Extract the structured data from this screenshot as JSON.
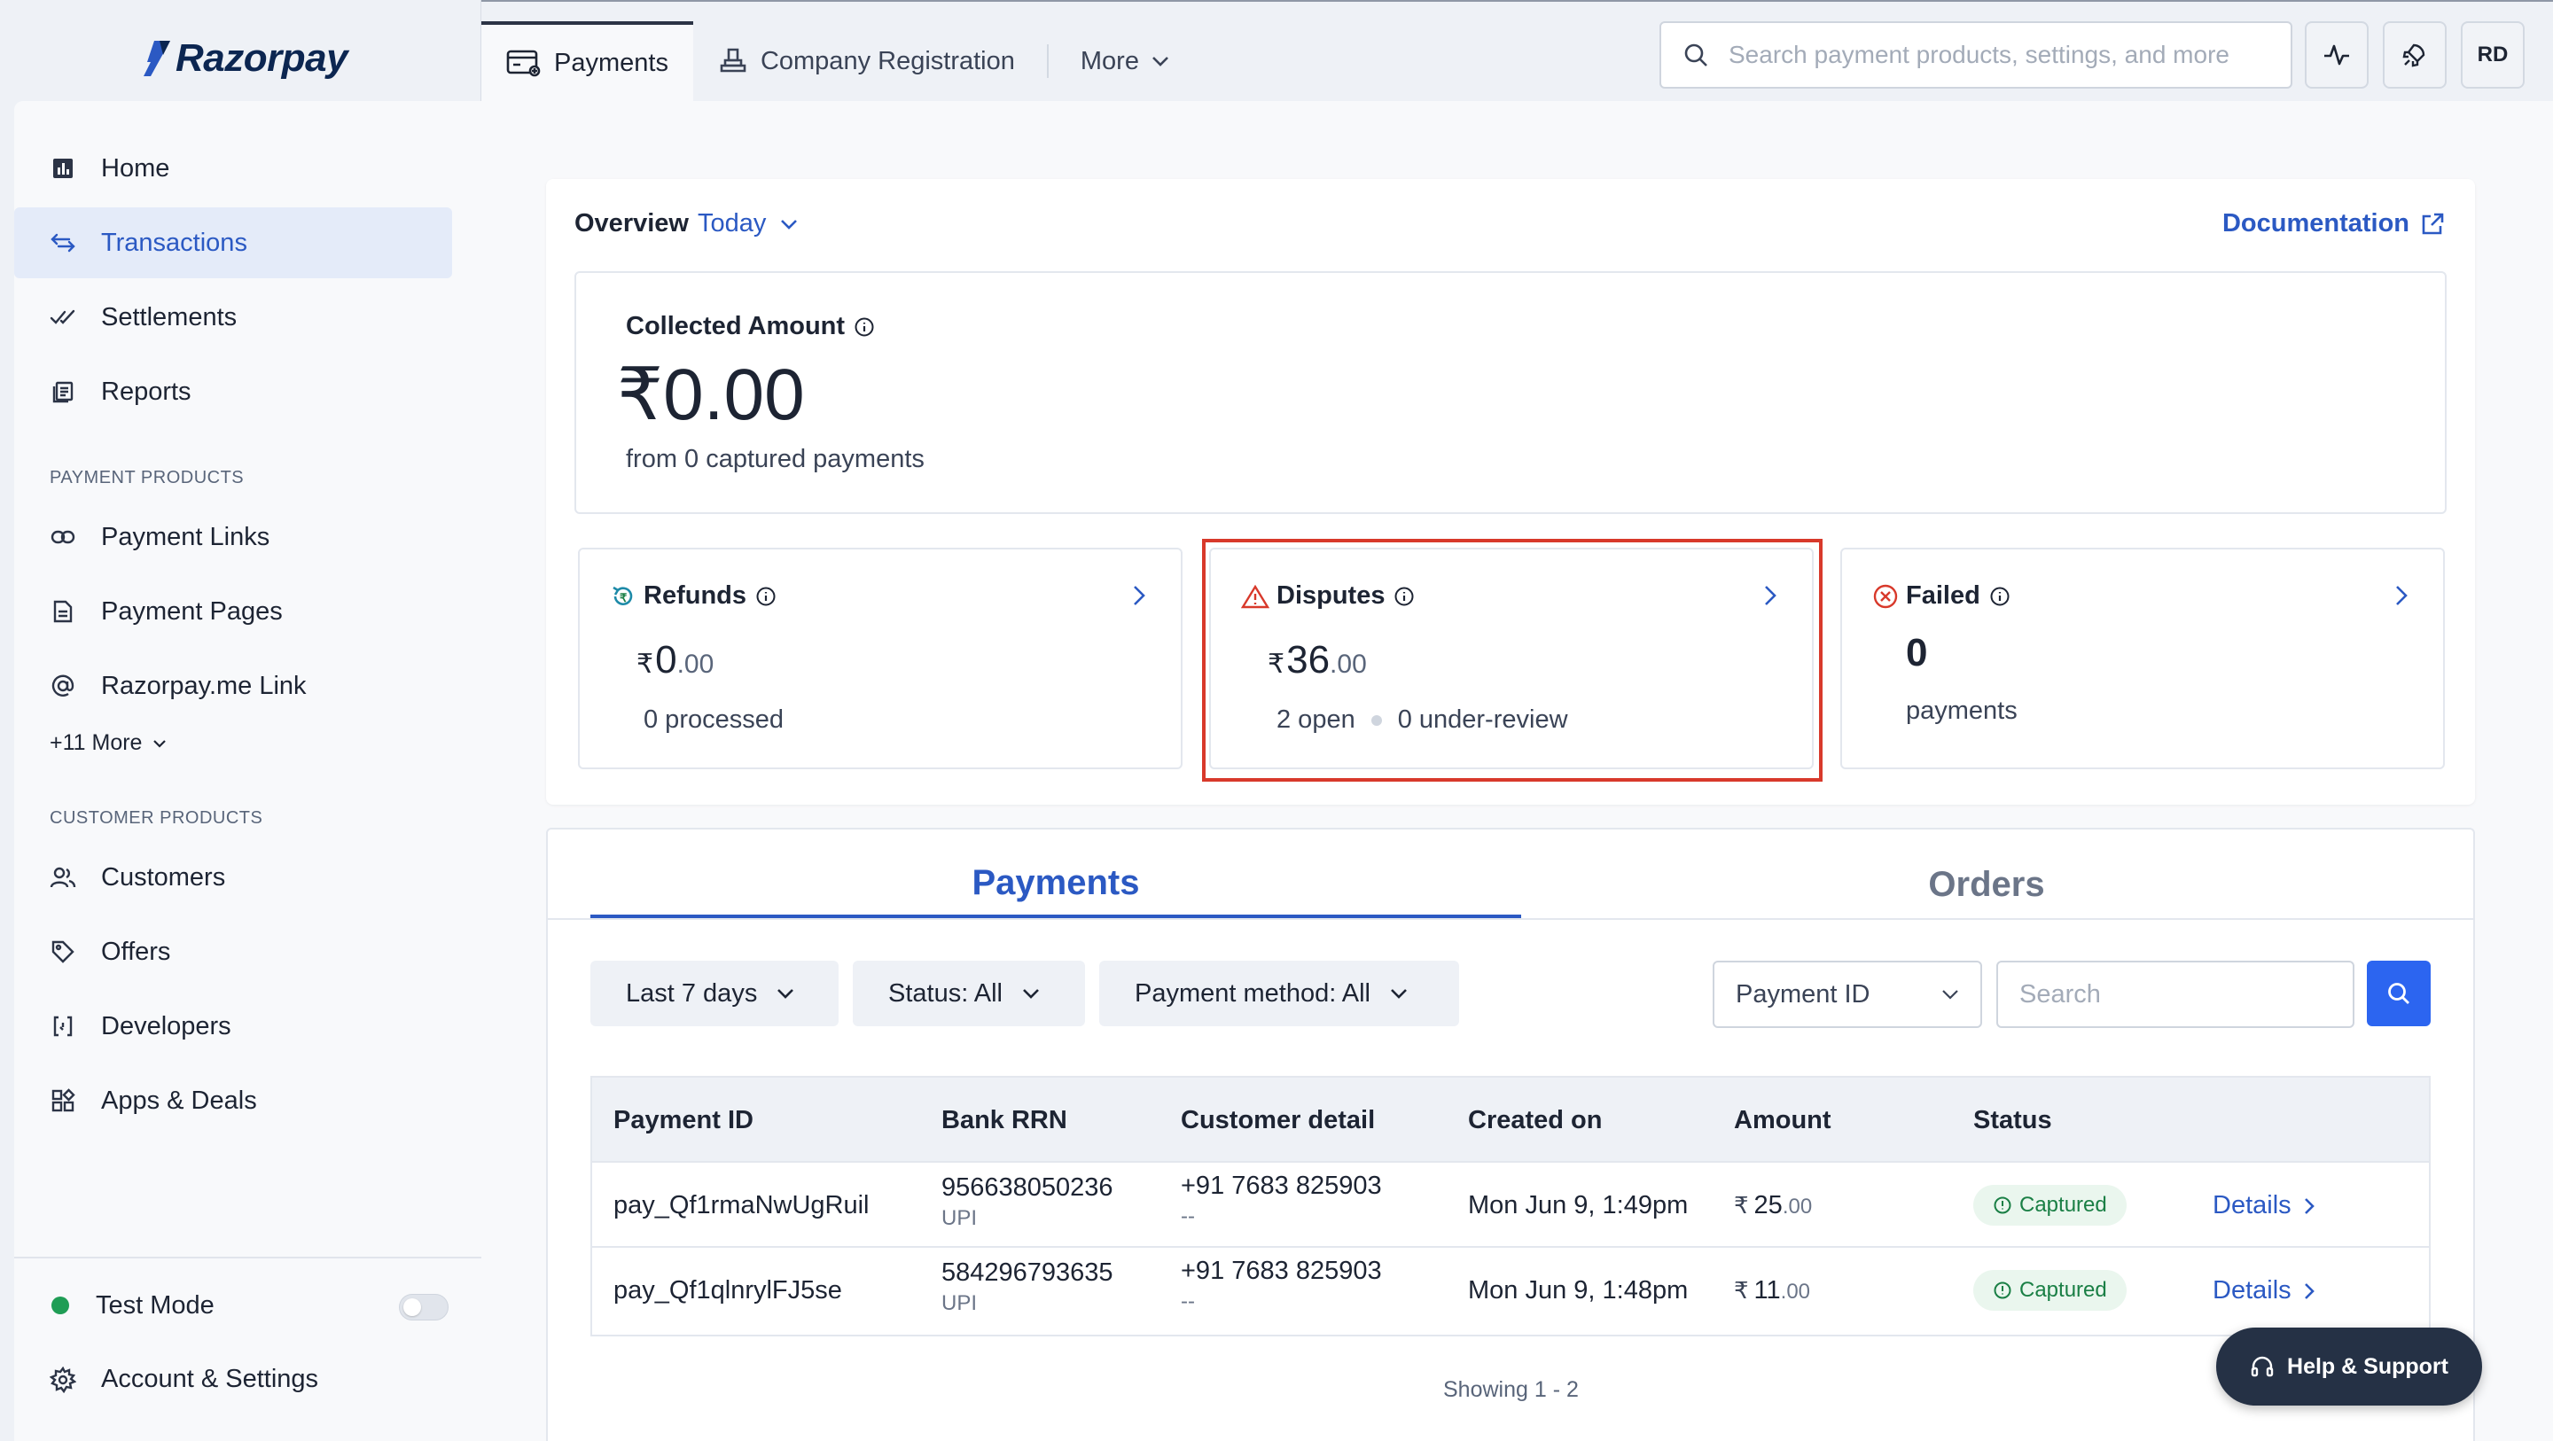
{
  "app": {
    "logo_text": "Razorpay",
    "brand_color": "#2b59c3"
  },
  "sidebar": {
    "items_top": [
      {
        "label": "Home",
        "icon": "bar-chart-icon"
      },
      {
        "label": "Transactions",
        "icon": "arrows-exchange-icon",
        "active": true
      },
      {
        "label": "Settlements",
        "icon": "double-check-icon"
      },
      {
        "label": "Reports",
        "icon": "reports-icon"
      }
    ],
    "payment_products_label": "PAYMENT PRODUCTS",
    "payment_products": [
      {
        "label": "Payment Links",
        "icon": "link-icon"
      },
      {
        "label": "Payment Pages",
        "icon": "page-icon"
      },
      {
        "label": "Razorpay.me Link",
        "icon": "at-icon"
      }
    ],
    "more_label": "+11 More",
    "customer_products_label": "CUSTOMER PRODUCTS",
    "customer_products": [
      {
        "label": "Customers",
        "icon": "users-icon"
      },
      {
        "label": "Offers",
        "icon": "tag-icon"
      },
      {
        "label": "Developers",
        "icon": "code-icon"
      },
      {
        "label": "Apps & Deals",
        "icon": "apps-icon"
      }
    ],
    "test_mode_label": "Test Mode",
    "account_label": "Account & Settings"
  },
  "topnav": {
    "tabs": [
      {
        "label": "Payments",
        "icon": "payments-icon",
        "active": true
      },
      {
        "label": "Company Registration",
        "icon": "stamp-icon"
      },
      {
        "label": "More",
        "icon": "chevron-down-icon"
      }
    ],
    "search_placeholder": "Search payment products, settings, and more",
    "avatar_initials": "RD"
  },
  "overview": {
    "title": "Overview",
    "period": "Today",
    "documentation_label": "Documentation",
    "collected": {
      "label": "Collected Amount",
      "amount": "₹0.00",
      "sub": "from 0 captured payments"
    },
    "refunds": {
      "label": "Refunds",
      "currency": "₹",
      "whole": "0",
      "decimal": ".00",
      "desc": "0 processed"
    },
    "disputes": {
      "label": "Disputes",
      "currency": "₹",
      "whole": "36",
      "decimal": ".00",
      "open": "2 open",
      "review": "0 under-review"
    },
    "failed": {
      "label": "Failed",
      "value": "0",
      "desc": "payments"
    }
  },
  "payments": {
    "tabs": [
      "Payments",
      "Orders"
    ],
    "filters": [
      "Last 7 days",
      "Status: All",
      "Payment method: All"
    ],
    "search_field": "Payment ID",
    "search_placeholder": "Search",
    "columns": [
      "Payment ID",
      "Bank RRN",
      "Customer detail",
      "Created on",
      "Amount",
      "Status"
    ],
    "rows": [
      {
        "id": "pay_Qf1rmaNwUgRuil",
        "rrn": "956638050236",
        "method": "UPI",
        "phone": "+91 7683 825903",
        "email": "--",
        "created": "Mon Jun 9, 1:49pm",
        "currency": "₹",
        "amount_whole": "25",
        "amount_dec": ".00",
        "status": "Captured",
        "action": "Details"
      },
      {
        "id": "pay_Qf1qlnrylFJ5se",
        "rrn": "584296793635",
        "method": "UPI",
        "phone": "+91 7683 825903",
        "email": "--",
        "created": "Mon Jun 9, 1:48pm",
        "currency": "₹",
        "amount_whole": "11",
        "amount_dec": ".00",
        "status": "Captured",
        "action": "Details"
      }
    ],
    "showing": "Showing 1 - 2"
  },
  "help_label": "Help & Support"
}
